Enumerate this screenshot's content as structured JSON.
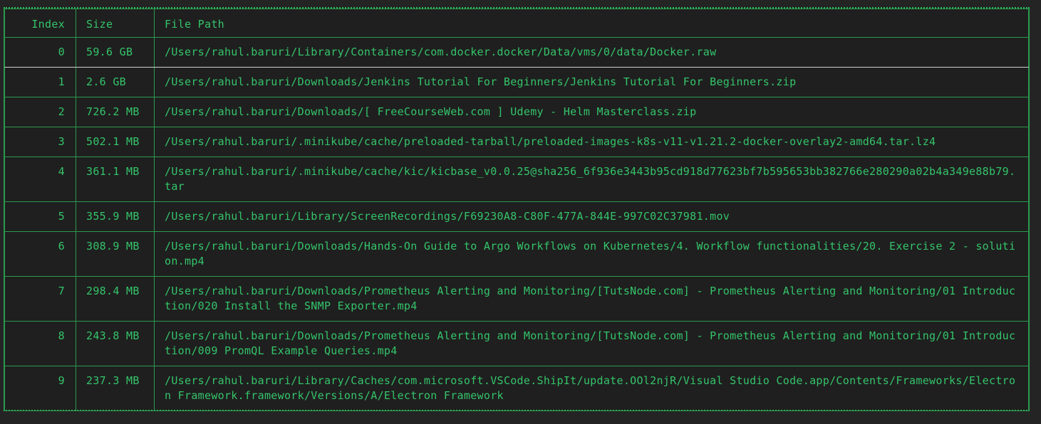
{
  "table": {
    "headers": {
      "index": "Index",
      "size": "Size",
      "path": "File Path"
    },
    "rows": [
      {
        "index": "0",
        "size": "59.6 GB",
        "path": "/Users/rahul.baruri/Library/Containers/com.docker.docker/Data/vms/0/data/Docker.raw"
      },
      {
        "index": "1",
        "size": "2.6 GB",
        "path": "/Users/rahul.baruri/Downloads/Jenkins Tutorial For Beginners/Jenkins Tutorial For Beginners.zip"
      },
      {
        "index": "2",
        "size": "726.2 MB",
        "path": "/Users/rahul.baruri/Downloads/[ FreeCourseWeb.com ] Udemy - Helm Masterclass.zip"
      },
      {
        "index": "3",
        "size": "502.1 MB",
        "path": "/Users/rahul.baruri/.minikube/cache/preloaded-tarball/preloaded-images-k8s-v11-v1.21.2-docker-overlay2-amd64.tar.lz4"
      },
      {
        "index": "4",
        "size": "361.1 MB",
        "path": "/Users/rahul.baruri/.minikube/cache/kic/kicbase_v0.0.25@sha256_6f936e3443b95cd918d77623bf7b595653bb382766e280290a02b4a349e88b79.tar"
      },
      {
        "index": "5",
        "size": "355.9 MB",
        "path": "/Users/rahul.baruri/Library/ScreenRecordings/F69230A8-C80F-477A-844E-997C02C37981.mov"
      },
      {
        "index": "6",
        "size": "308.9 MB",
        "path": "/Users/rahul.baruri/Downloads/Hands-On Guide to Argo Workflows on Kubernetes/4. Workflow functionalities/20. Exercise 2 - solution.mp4"
      },
      {
        "index": "7",
        "size": "298.4 MB",
        "path": "/Users/rahul.baruri/Downloads/Prometheus Alerting and Monitoring/[TutsNode.com] - Prometheus Alerting and Monitoring/01 Introduction/020 Install the SNMP Exporter.mp4"
      },
      {
        "index": "8",
        "size": "243.8 MB",
        "path": "/Users/rahul.baruri/Downloads/Prometheus Alerting and Monitoring/[TutsNode.com] - Prometheus Alerting and Monitoring/01 Introduction/009 PromQL Example Queries.mp4"
      },
      {
        "index": "9",
        "size": "237.3 MB",
        "path": "/Users/rahul.baruri/Library/Caches/com.microsoft.VSCode.ShipIt/update.OOl2njR/Visual Studio Code.app/Contents/Frameworks/Electron Framework.framework/Versions/A/Electron Framework"
      }
    ]
  },
  "colors": {
    "accent": "#34c46a",
    "border": "#2a9a4e",
    "background": "#242424",
    "selection_line": "#cfcfcf"
  }
}
